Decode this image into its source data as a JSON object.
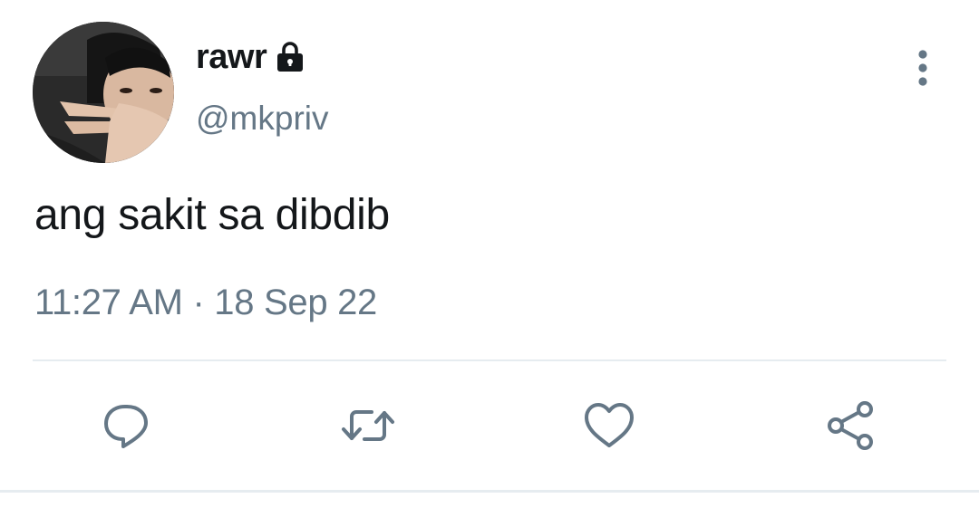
{
  "user": {
    "display_name": "rawr",
    "handle": "@mkpriv",
    "protected_icon": "lock-icon"
  },
  "tweet": {
    "text": "ang sakit sa dibdib",
    "time": "11:27 AM",
    "separator": " · ",
    "date": "18 Sep 22"
  },
  "actions": {
    "more": "more-vertical-icon",
    "reply": "reply-icon",
    "retweet": "retweet-icon",
    "like": "heart-icon",
    "share": "share-icon"
  },
  "colors": {
    "text": "#14171a",
    "secondary": "#657786",
    "divider": "#e6ecf0"
  }
}
